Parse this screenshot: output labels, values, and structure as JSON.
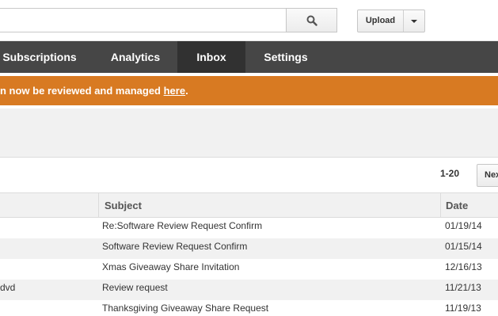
{
  "header": {
    "search_placeholder": "",
    "upload_label": "Upload"
  },
  "nav": {
    "tabs": [
      {
        "label": "Subscriptions"
      },
      {
        "label": "Analytics"
      },
      {
        "label": "Inbox",
        "active": true
      },
      {
        "label": "Settings"
      }
    ]
  },
  "banner": {
    "text_before": "n now be reviewed and managed ",
    "link_text": "here",
    "text_after": ".",
    "color": "#d87a22"
  },
  "pager": {
    "range": "1-20",
    "next_label": "Next"
  },
  "table": {
    "columns": [
      "Subject",
      "Date"
    ],
    "rows": [
      {
        "from": "",
        "subject": "Re:Software Review Request Confirm",
        "date": "01/19/14"
      },
      {
        "from": "",
        "subject": "Software Review Request Confirm",
        "date": "01/15/14"
      },
      {
        "from": "",
        "subject": "Xmas Giveaway Share Invitation",
        "date": "12/16/13"
      },
      {
        "from": "dvd",
        "subject": "Review request",
        "date": "11/21/13"
      },
      {
        "from": "",
        "subject": "Thanksgiving Giveaway Share Request",
        "date": "11/19/13"
      }
    ]
  },
  "icons": {
    "search": "search-icon",
    "dropdown": "chevron-down-icon"
  }
}
